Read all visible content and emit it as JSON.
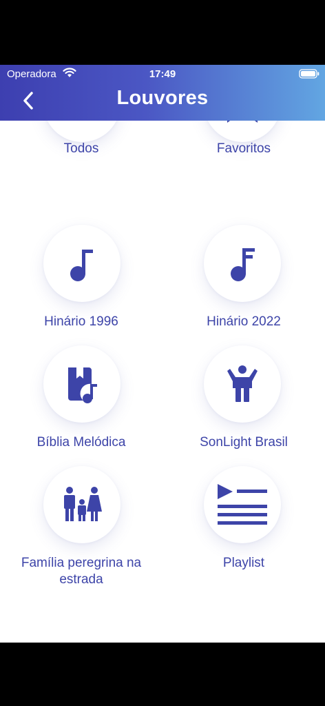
{
  "status_bar": {
    "carrier": "Operadora",
    "time": "17:49"
  },
  "header": {
    "title": "Louvores",
    "back_icon": "chevron-left-icon"
  },
  "colors": {
    "accent": "#3d44a8",
    "header_gradient_start": "#3d3fb0",
    "header_gradient_end": "#62a6e2"
  },
  "tiles": [
    {
      "label": "Todos",
      "icon": "music-notes-icon"
    },
    {
      "label": "Favoritos",
      "icon": "bookmark-icon"
    },
    {
      "label": "Hinário 1996",
      "icon": "music-note-icon"
    },
    {
      "label": "Hinário 2022",
      "icon": "music-note-flag-icon"
    },
    {
      "label": "Bíblia Melódica",
      "icon": "book-music-icon"
    },
    {
      "label": "SonLight Brasil",
      "icon": "child-icon"
    },
    {
      "label": "Família peregrina na estrada",
      "icon": "family-icon"
    },
    {
      "label": "Playlist",
      "icon": "playlist-icon"
    }
  ]
}
